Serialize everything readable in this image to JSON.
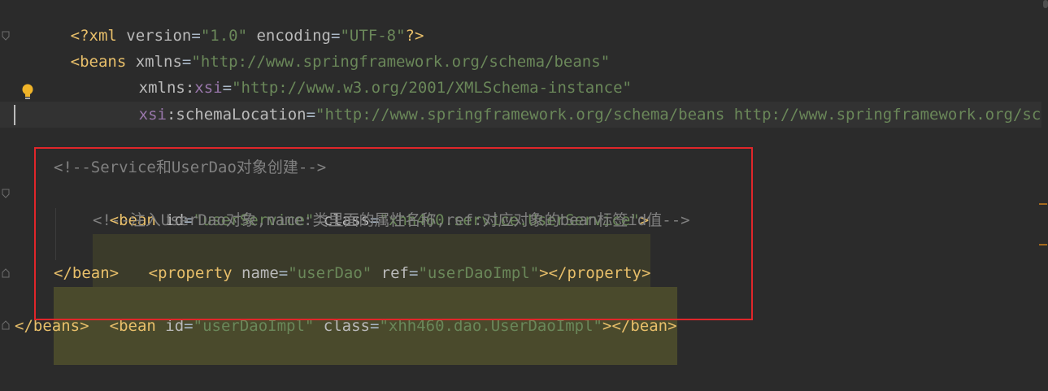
{
  "lines": {
    "l1": [
      "<?xml ",
      "version",
      "=",
      "\"1.0\"",
      " ",
      "encoding",
      "=",
      "\"UTF-8\"",
      "?>"
    ],
    "l2": [
      "<beans ",
      "xmlns",
      "=",
      "\"http://www.springframework.org/schema/beans\""
    ],
    "l3": [
      "xmlns",
      ":",
      "xsi",
      "=",
      "\"http://www.w3.org/2001/XMLSchema-instance\""
    ],
    "l4": [
      "xsi",
      ":",
      "schemaLocation",
      "=",
      "\"http://www.springframework.org/schema/beans http://www.springframework.org/sche"
    ],
    "l6": [
      "<!--Service和UserDao对象创建-->"
    ],
    "l7": [
      "<bean ",
      "id",
      "=",
      "\"userService\"",
      " ",
      "class",
      "=",
      "\"xhh460.service.UserService\"",
      ">"
    ],
    "l8": [
      "<!--注入UserDao对象,name:类里面的属性名称,ref:对应对象的bean标签id值-->"
    ],
    "l9": [
      "<property ",
      "name",
      "=",
      "\"userDao\"",
      " ",
      "ref",
      "=",
      "\"userDaoImpl\"",
      "></property>"
    ],
    "l10": [
      "</bean>"
    ],
    "l11": [
      "<bean ",
      "id",
      "=",
      "\"userDaoImpl\"",
      " ",
      "class",
      "=",
      "\"xhh460.dao.UserDaoImpl\"",
      "></bean>"
    ],
    "l12": [
      "</beans>"
    ]
  },
  "icons": {
    "bulb": "lightbulb-icon",
    "fold": "fold-marker-icon"
  },
  "colors": {
    "background": "#2b2b2b",
    "tag": "#e8bf6a",
    "attribute": "#bababa",
    "namespace": "#9876aa",
    "string": "#6a8759",
    "comment": "#808080",
    "highlight_box": "#e0262a"
  }
}
